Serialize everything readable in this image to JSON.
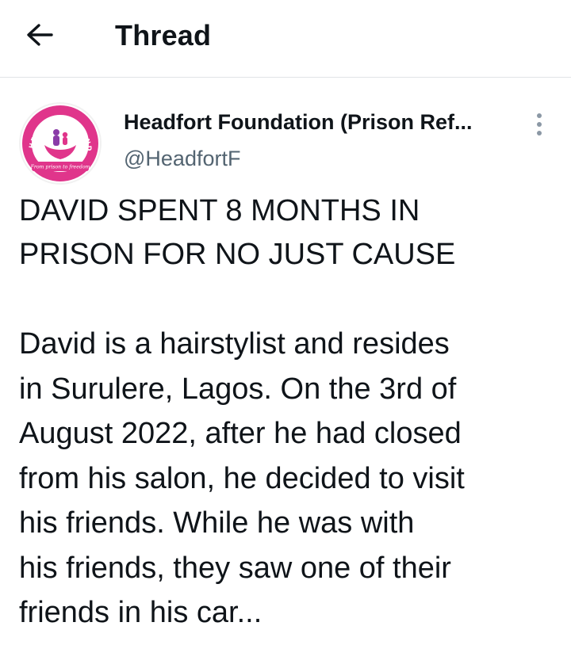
{
  "header": {
    "title": "Thread",
    "back_icon": "arrow-left-icon"
  },
  "tweet": {
    "author": {
      "name": "Headfort Foundation (Prison Ref...",
      "handle": "@HeadfortF",
      "avatar_logo_text": "HEADFORT FOUNDATION",
      "avatar_tagline": "From prison to freedom"
    },
    "more_icon": "more-vertical-icon",
    "headline_lines": [
      "DAVID SPENT 8 MONTHS IN",
      "PRISON FOR NO JUST CAUSE"
    ],
    "body_lines": [
      "David is a hairstylist and resides",
      "in Surulere, Lagos. On the 3rd of",
      "August 2022, after he had closed",
      "from his salon, he decided to visit",
      "his friends. While he was with",
      "his friends, they saw one of their",
      "friends in his car..."
    ]
  },
  "colors": {
    "text_primary": "#0f1419",
    "text_secondary": "#536471",
    "divider": "#e1e4e6",
    "logo_pink": "#e0358b",
    "logo_purple": "#8a3ca8"
  }
}
